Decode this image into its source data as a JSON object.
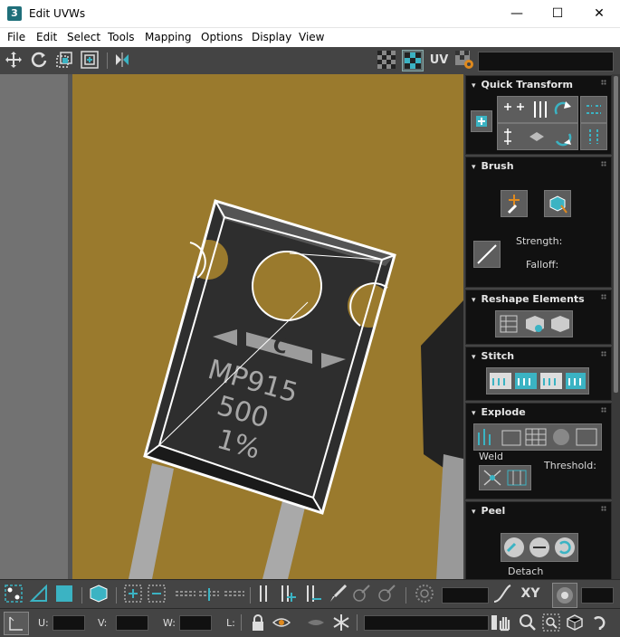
{
  "window": {
    "app_icon_text": "3",
    "title": "Edit UVWs",
    "minimize": "—",
    "maximize": "☐",
    "close": "✕"
  },
  "menu": [
    "File",
    "Edit",
    "Select",
    "Tools",
    "Mapping",
    "Options",
    "Display",
    "View"
  ],
  "toolbar": {
    "uv_label": "UV"
  },
  "viewport": {
    "component_logo": "C",
    "component_text_line1": "MP915",
    "component_text_line2": "500",
    "component_text_line3": "1%"
  },
  "panel": {
    "quick_transform": {
      "title": "Quick Transform"
    },
    "brush": {
      "title": "Brush",
      "strength_label": "Strength:",
      "falloff_label": "Falloff:"
    },
    "reshape": {
      "title": "Reshape Elements"
    },
    "stitch": {
      "title": "Stitch"
    },
    "explode": {
      "title": "Explode",
      "weld_label": "Weld",
      "threshold_label": "Threshold:"
    },
    "peel": {
      "title": "Peel",
      "detach_label": "Detach"
    }
  },
  "bottom": {
    "xy_label": "XY",
    "u_label": "U:",
    "v_label": "V:",
    "w_label": "W:",
    "l_label": "L:"
  },
  "colors": {
    "accent": "#3bb3c3",
    "panel_bg": "#444444",
    "rollout_bg": "#111111",
    "viewport_bg": "#8b6e2a",
    "component_body": "#2e2e2e"
  }
}
